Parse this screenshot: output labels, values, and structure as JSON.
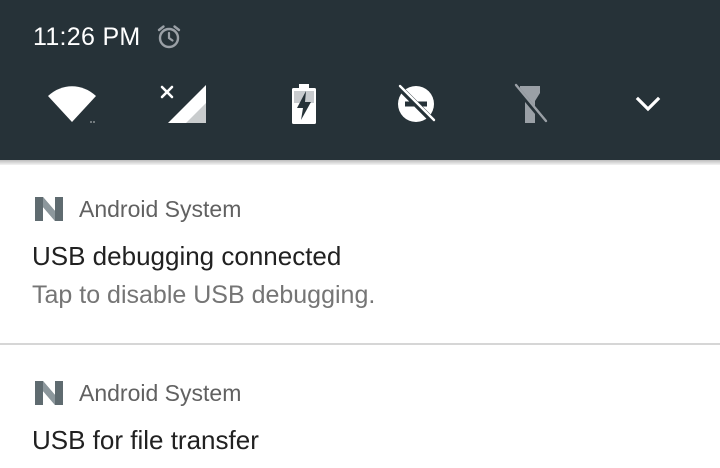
{
  "status_bar": {
    "time": "11:26 PM",
    "alarm_icon": "alarm-clock-icon"
  },
  "quick_settings": {
    "tiles": [
      {
        "name": "wifi",
        "icon": "wifi-icon"
      },
      {
        "name": "cellular",
        "icon": "cellular-no-sim-icon"
      },
      {
        "name": "battery",
        "icon": "battery-charging-icon"
      },
      {
        "name": "do-not-disturb",
        "icon": "do-not-disturb-off-icon"
      },
      {
        "name": "flashlight",
        "icon": "flashlight-off-icon"
      },
      {
        "name": "expand",
        "icon": "chevron-down-icon"
      }
    ]
  },
  "notifications": [
    {
      "app": "Android System",
      "title": "USB debugging connected",
      "text": "Tap to disable USB debugging."
    },
    {
      "app": "Android System",
      "title": "USB for file transfer"
    }
  ],
  "colors": {
    "shade_background": "#263238",
    "card_background": "#ffffff",
    "icon_color": "#ffffff"
  }
}
